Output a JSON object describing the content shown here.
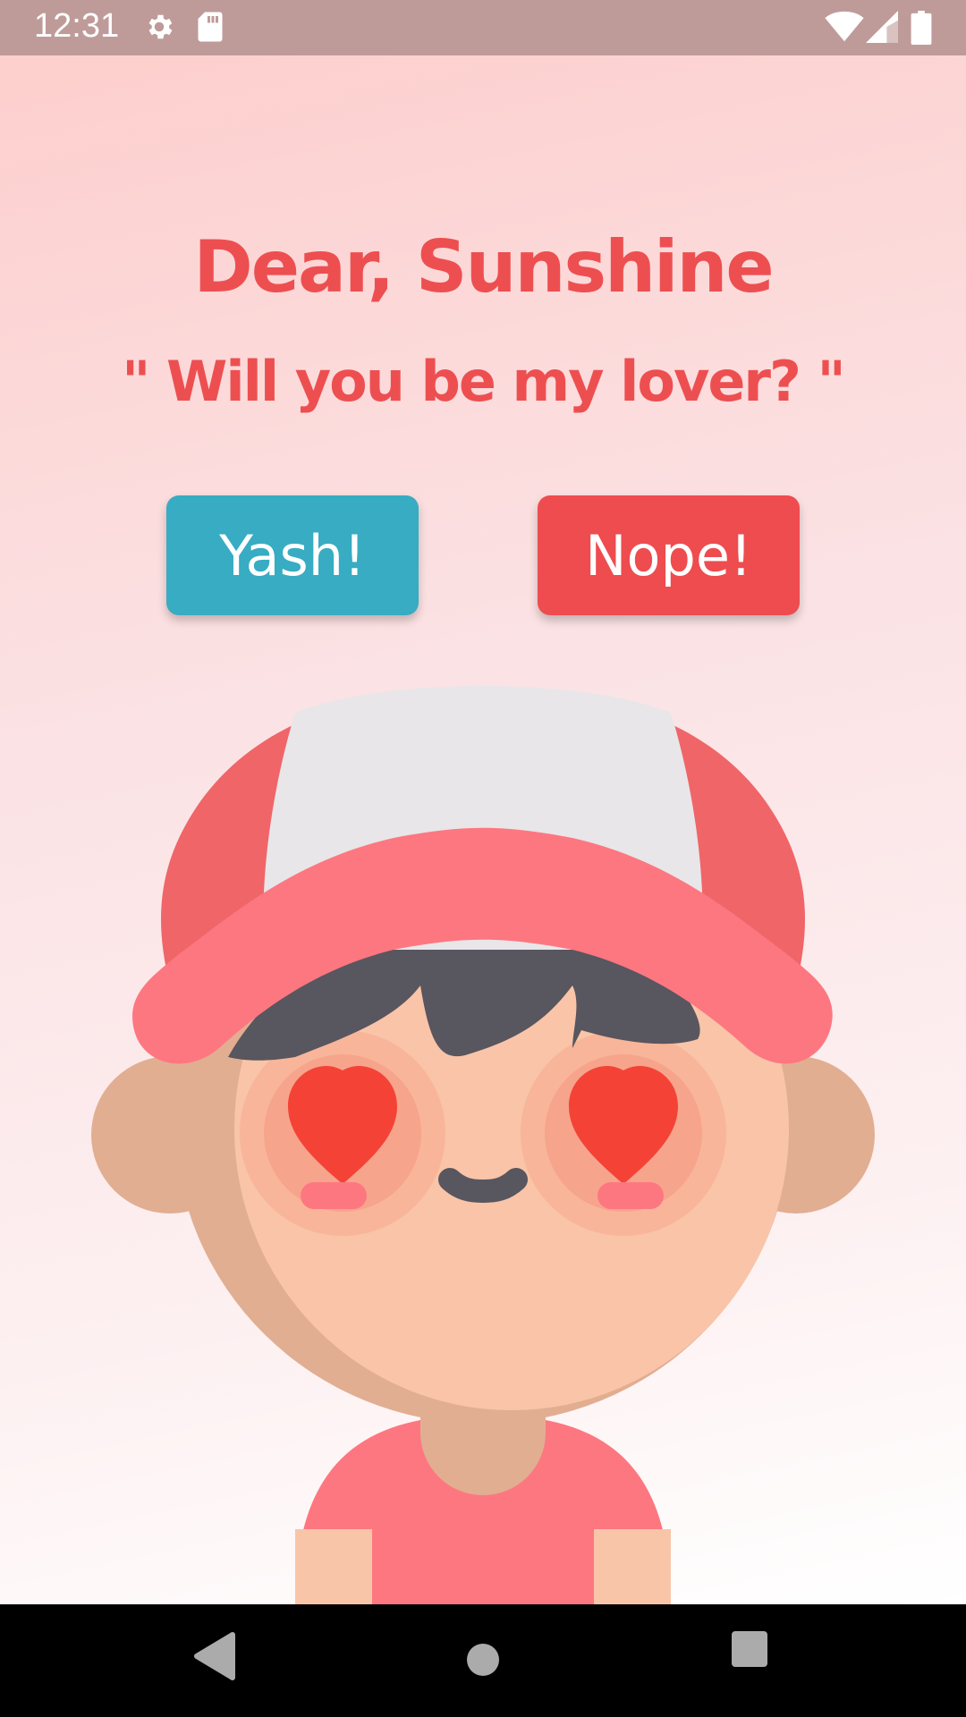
{
  "status_bar": {
    "time": "12:31",
    "icons": [
      "settings-icon",
      "sd-card-icon",
      "wifi-icon",
      "signal-icon",
      "battery-icon"
    ]
  },
  "main": {
    "greeting": "Dear, Sunshine",
    "question": "\" Will you be my lover? \"",
    "yes_button": "Yash!",
    "no_button": "Nope!"
  },
  "colors": {
    "accent_red": "#ed4f51",
    "yes_teal": "#37acc2",
    "status_bar": "#be9b99"
  },
  "nav_bar": {
    "icons": [
      "back-icon",
      "home-icon",
      "recents-icon"
    ]
  }
}
